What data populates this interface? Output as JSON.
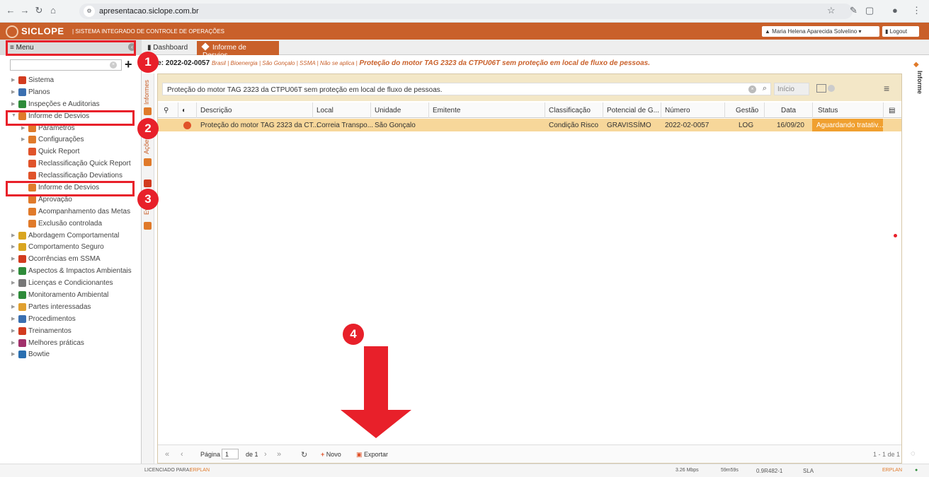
{
  "browser": {
    "url": "apresentacao.siclope.com.br"
  },
  "header": {
    "logo": "SICLOPE",
    "system_label": "| SISTEMA INTEGRADO DE CONTROLE DE OPERAÇÕES",
    "user": "Maria Helena Aparecida Solvelino",
    "logout": "Logout"
  },
  "sidebar": {
    "title": "Menu",
    "items": [
      {
        "label": "Sistema",
        "level": 0,
        "color": "#d23b1f"
      },
      {
        "label": "Planos",
        "level": 0,
        "color": "#3a6fb0"
      },
      {
        "label": "Inspeções e Auditorias",
        "level": 0,
        "color": "#2e8b3a"
      },
      {
        "label": "Informe de Desvios",
        "level": 0,
        "color": "#e07a2a"
      },
      {
        "label": "Parâmetros",
        "level": 1,
        "color": "#e07a2a"
      },
      {
        "label": "Configurações",
        "level": 1,
        "color": "#e07a2a"
      },
      {
        "label": "Quick Report",
        "level": 1,
        "color": "#e0532a"
      },
      {
        "label": "Reclassificação Quick Report",
        "level": 1,
        "color": "#e0532a"
      },
      {
        "label": "Reclassificação Deviations",
        "level": 1,
        "color": "#e0532a"
      },
      {
        "label": "Informe de Desvios",
        "level": 1,
        "color": "#e07a2a"
      },
      {
        "label": "Aprovação",
        "level": 1,
        "color": "#e07a2a"
      },
      {
        "label": "Acompanhamento das Metas",
        "level": 1,
        "color": "#e07a2a"
      },
      {
        "label": "Exclusão controlada",
        "level": 1,
        "color": "#e07a2a"
      },
      {
        "label": "Abordagem Comportamental",
        "level": 0,
        "color": "#d9a520"
      },
      {
        "label": "Comportamento Seguro",
        "level": 0,
        "color": "#d9a520"
      },
      {
        "label": "Ocorrências em SSMA",
        "level": 0,
        "color": "#d23b1f"
      },
      {
        "label": "Aspectos & Impactos Ambientais",
        "level": 0,
        "color": "#2e8b3a"
      },
      {
        "label": "Licenças e Condicionantes",
        "level": 0,
        "color": "#777777"
      },
      {
        "label": "Monitoramento Ambiental",
        "level": 0,
        "color": "#2e8b3a"
      },
      {
        "label": "Partes interessadas",
        "level": 0,
        "color": "#e0a030"
      },
      {
        "label": "Procedimentos",
        "level": 0,
        "color": "#3a6fb0"
      },
      {
        "label": "Treinamentos",
        "level": 0,
        "color": "#d23b1f"
      },
      {
        "label": "Melhores práticas",
        "level": 0,
        "color": "#a0306a"
      },
      {
        "label": "Bowtie",
        "level": 0,
        "color": "#2a6fb0"
      }
    ]
  },
  "vstrip": {
    "informes": "Informes",
    "acoes": "Ações",
    "ev": "Ev"
  },
  "tabs": {
    "dashboard": "Dashboard",
    "active": "Informe de Desvios"
  },
  "info": {
    "id": "forme: 2022-02-0057",
    "crumbs": "Brasil | Bioenergia | São Gonçalo | SSMA | Não se aplica |",
    "title": "Proteção do motor TAG 2323 da CTPU06T sem proteção em local de fluxo de pessoas."
  },
  "filter": {
    "value": "Proteção do motor TAG 2323 da CTPU06T sem proteção em local de fluxo de pessoas.",
    "inicio_placeholder": "Início"
  },
  "table": {
    "columns": [
      "Descrição",
      "Local",
      "Unidade",
      "Emitente",
      "Classificação",
      "Potencial de G...",
      "Número",
      "Gestão",
      "Data",
      "Status"
    ],
    "rows": [
      {
        "descricao": "Proteção do motor TAG 2323 da CT...",
        "local": "Correia Transpo...",
        "unidade": "São Gonçalo",
        "emitente": "",
        "classificacao": "Condição Risco",
        "potencial": "GRAVISSÍMO",
        "numero": "2022-02-0057",
        "gestao": "LOG",
        "data": "16/09/20",
        "status": "Aguardando tratativ..."
      }
    ]
  },
  "footer": {
    "pagina": "Página",
    "page": "1",
    "de": "de 1",
    "novo": "Novo",
    "exportar": "Exportar",
    "count": "1 - 1 de 1"
  },
  "rightpanel": {
    "label": "Informe"
  },
  "statusbar": {
    "licenciado": "LICENCIADO PARA:",
    "erplan": "ERPLAN",
    "speed": "3.26 Mbps",
    "time": "59m59s",
    "version": "0.9R482-1",
    "sla": "SLA"
  },
  "annotations": {
    "b1": "1",
    "b2": "2",
    "b3": "3",
    "b4": "4"
  },
  "colors": {
    "brand": "#c9602a",
    "highlight": "#e8202a",
    "row": "#f7d79a",
    "status": "#f0a030"
  }
}
